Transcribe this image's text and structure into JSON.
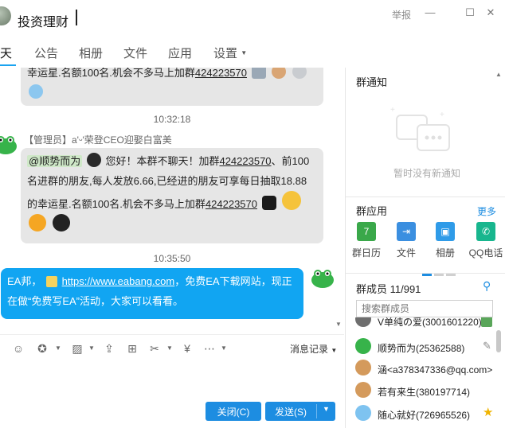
{
  "window": {
    "title": "投资理财",
    "report": "举报",
    "min": "—",
    "max": "☐",
    "close": "✕"
  },
  "tabs": [
    {
      "label": "天"
    },
    {
      "label": "公告"
    },
    {
      "label": "相册"
    },
    {
      "label": "文件"
    },
    {
      "label": "应用"
    },
    {
      "label": "设置"
    }
  ],
  "messages": {
    "m1_line": "幸运星.名额100名.机会不多马上加群",
    "m1_num": "424223570",
    "t1": "10:32:18",
    "m2_sender": "【管理员】a'ᵕ'荣登CEO迎娶白富美",
    "m2_mention": "@顺势而为",
    "m2_l1a": "您好！本群不聊天！加群",
    "m2_l1num": "424223570",
    "m2_l1b": "、前100",
    "m2_l2": "名进群的朋友,每人发放6.66,已经进的朋友可享每日抽取18.88",
    "m2_l3a": "的幸运星.名额100名.机会不多马上加群",
    "m2_l3num": "424223570",
    "t2": "10:35:50",
    "m3_a": "EA邦，",
    "m3_link": "https://www.eabang.com",
    "m3_b": "，免费EA下载网站，现正",
    "m3_l2": "在做“免费写EA”活动，大家可以看看。"
  },
  "toolbar": {
    "history": "消息记录",
    "close_btn": "关闭(C)",
    "send_btn": "发送(S)"
  },
  "right": {
    "notice_title": "群通知",
    "notice_empty": "暂时没有新通知",
    "apps_title": "群应用",
    "more": "更多",
    "apps": [
      {
        "label": "群日历",
        "color": "#3aa84a",
        "glyph": "7"
      },
      {
        "label": "文件",
        "color": "#3b8fe0",
        "glyph": "⇥"
      },
      {
        "label": "相册",
        "color": "#2f9be8",
        "glyph": "▣"
      },
      {
        "label": "QQ电话",
        "color": "#18b68e",
        "glyph": "✆"
      }
    ],
    "members_title": "群成员 11/991",
    "search_placeholder": "搜索群成员",
    "members": [
      {
        "name": "V单纯の爱(3001601220)"
      },
      {
        "name": "顺势而为(25362588)"
      },
      {
        "name": "涵<a378347336@qq.com>"
      },
      {
        "name": "若有来生(380197714)"
      },
      {
        "name": "随心就好(726965526)"
      }
    ]
  }
}
